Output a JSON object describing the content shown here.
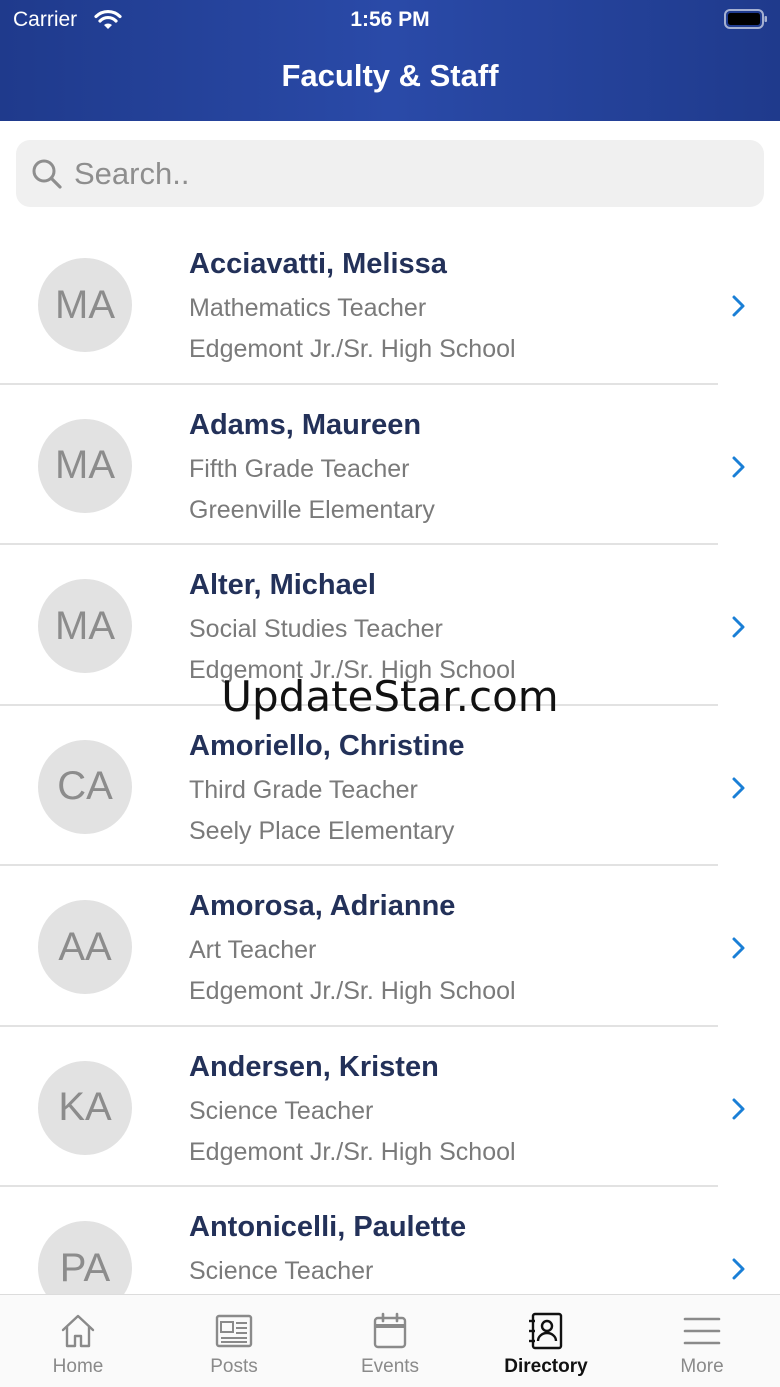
{
  "status_bar": {
    "carrier": "Carrier",
    "time": "1:56 PM"
  },
  "header": {
    "title": "Faculty & Staff"
  },
  "search": {
    "placeholder": "Search.."
  },
  "directory": [
    {
      "initials": "MA",
      "name": "Acciavatti, Melissa",
      "role": "Mathematics Teacher",
      "school": "Edgemont Jr./Sr. High School"
    },
    {
      "initials": "MA",
      "name": "Adams, Maureen",
      "role": "Fifth Grade Teacher",
      "school": "Greenville Elementary"
    },
    {
      "initials": "MA",
      "name": "Alter, Michael",
      "role": "Social Studies Teacher",
      "school": "Edgemont Jr./Sr. High School"
    },
    {
      "initials": "CA",
      "name": "Amoriello, Christine",
      "role": "Third Grade Teacher",
      "school": "Seely Place Elementary"
    },
    {
      "initials": "AA",
      "name": "Amorosa, Adrianne",
      "role": "Art Teacher",
      "school": "Edgemont Jr./Sr. High School"
    },
    {
      "initials": "KA",
      "name": "Andersen, Kristen",
      "role": "Science Teacher",
      "school": "Edgemont Jr./Sr. High School"
    },
    {
      "initials": "PA",
      "name": "Antonicelli, Paulette",
      "role": "Science Teacher",
      "school": ""
    }
  ],
  "watermark": "UpdateStar.com",
  "tabs": [
    {
      "label": "Home",
      "icon": "home-icon"
    },
    {
      "label": "Posts",
      "icon": "newspaper-icon"
    },
    {
      "label": "Events",
      "icon": "calendar-icon"
    },
    {
      "label": "Directory",
      "icon": "contact-book-icon",
      "active": true
    },
    {
      "label": "More",
      "icon": "menu-icon"
    }
  ],
  "colors": {
    "header": "#2a4aa8",
    "name": "#233159",
    "chevron": "#1a7fd6"
  }
}
